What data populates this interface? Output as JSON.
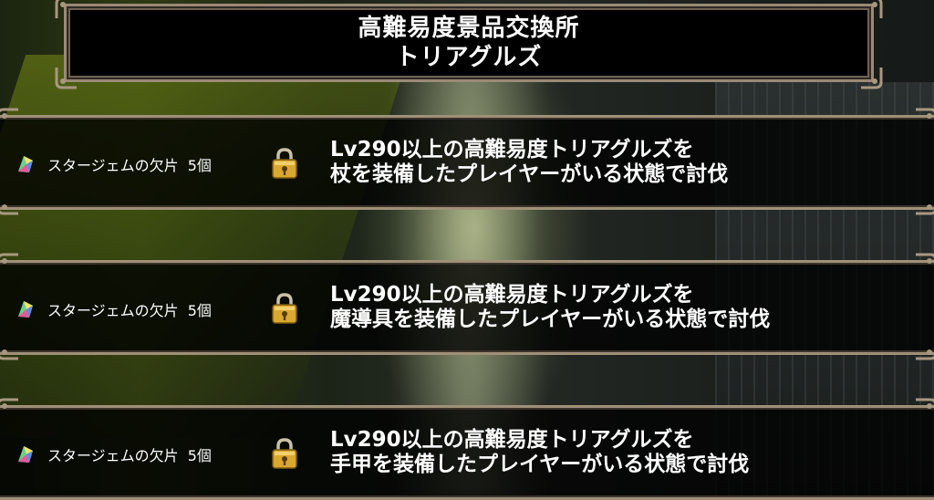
{
  "title": {
    "line1": "高難易度景品交換所",
    "line2": "トリアグルズ"
  },
  "rewards": [
    {
      "item_name": "スタージェムの欠片",
      "count": "5個",
      "locked": true,
      "condition_line1": "Lv290以上の高難易度トリアグルズを",
      "condition_line2": "杖を装備したプレイヤーがいる状態で討伐"
    },
    {
      "item_name": "スタージェムの欠片",
      "count": "5個",
      "locked": true,
      "condition_line1": "Lv290以上の高難易度トリアグルズを",
      "condition_line2": "魔導具を装備したプレイヤーがいる状態で討伐"
    },
    {
      "item_name": "スタージェムの欠片",
      "count": "5個",
      "locked": true,
      "condition_line1": "Lv290以上の高難易度トリアグルズを",
      "condition_line2": "手甲を装備したプレイヤーがいる状態で討伐"
    }
  ],
  "icons": {
    "reward_item": "star-gem-shard-icon",
    "lock": "padlock-icon",
    "corner": "ornament-corner-icon"
  },
  "colors": {
    "text": "#ffffff",
    "frame": "#a09078",
    "panel": "#000000",
    "lock_gold": "#d9a830"
  }
}
